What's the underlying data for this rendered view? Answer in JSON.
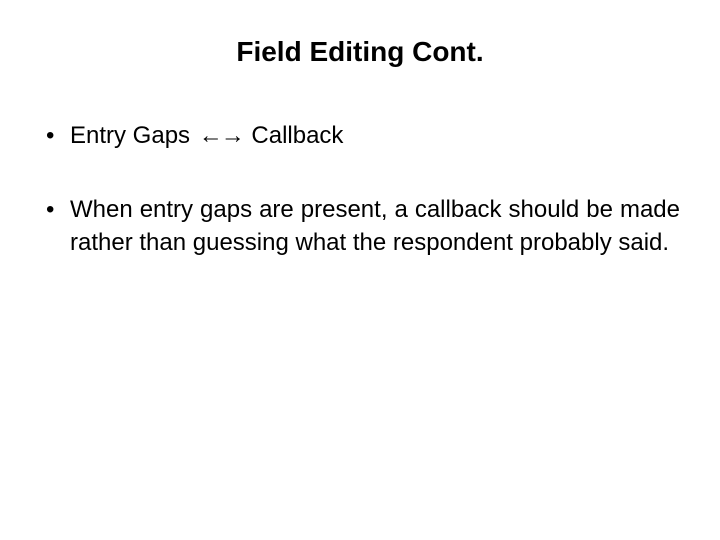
{
  "title": "Field Editing Cont.",
  "bullets": [
    {
      "prefix": "Entry Gaps ",
      "arrows": "←→",
      "suffix": " Callback"
    },
    {
      "text": "When entry gaps are present, a callback should be made rather than guessing what the respondent probably said."
    }
  ]
}
